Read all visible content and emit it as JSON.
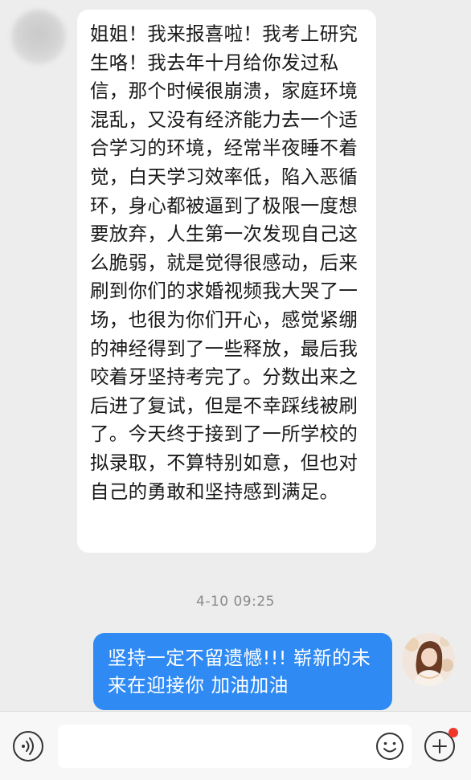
{
  "conversation": {
    "incoming_message": "姐姐！我来报喜啦！我考上研究生咯！我去年十月给你发过私信，那个时候很崩溃，家庭环境混乱，又没有经济能力去一个适合学习的环境，经常半夜睡不着觉，白天学习效率低，陷入恶循环，身心都被逼到了极限一度想要放弃，人生第一次发现自己这么脆弱，就是觉得很感动，后来刷到你们的求婚视频我大哭了一场，也很为你们开心，感觉紧绷的神经得到了一些释放，最后我咬着牙坚持考完了。分数出来之后进了复试，但是不幸踩线被刷了。今天终于接到了一所学校的拟录取，不算特别如意，但也对自己的勇敢和坚持感到满足。",
    "timestamp": "4-10 09:25",
    "outgoing_message": "坚持一定不留遗憾!!! 崭新的未来在迎接你  加油加油"
  },
  "input_bar": {
    "placeholder": "",
    "has_notification": true
  },
  "colors": {
    "background": "#ededed",
    "incoming_bubble": "#ffffff",
    "outgoing_bubble": "#2f8af3",
    "notification_dot": "#f0362c"
  },
  "icons": {
    "voice": "voice-icon",
    "emoji": "emoji-icon",
    "more": "plus-icon"
  }
}
